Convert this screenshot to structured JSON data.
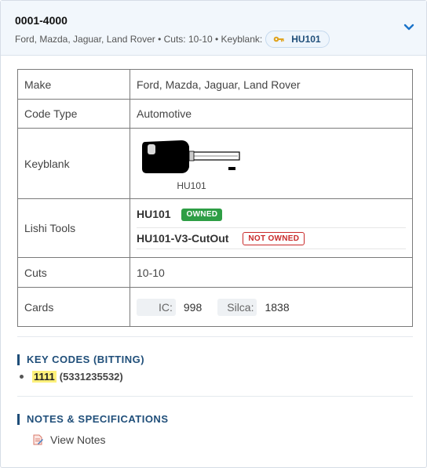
{
  "header": {
    "title": "0001-4000",
    "subtitle": "Ford, Mazda, Jaguar, Land Rover • Cuts: 10-10 • Keyblank:",
    "keyblank_pill": "HU101"
  },
  "spec_table": {
    "make": {
      "label": "Make",
      "value": "Ford, Mazda, Jaguar, Land Rover"
    },
    "code_type": {
      "label": "Code Type",
      "value": "Automotive"
    },
    "keyblank": {
      "label": "Keyblank",
      "caption": "HU101"
    },
    "lishi": {
      "label": "Lishi Tools",
      "tools": [
        {
          "name": "HU101",
          "status": "OWNED"
        },
        {
          "name": "HU101-V3-CutOut",
          "status": "NOT OWNED"
        }
      ]
    },
    "cuts": {
      "label": "Cuts",
      "value": "10-10"
    },
    "cards": {
      "label": "Cards",
      "items": [
        {
          "tag": "IC:",
          "value": "998"
        },
        {
          "tag": "Silca:",
          "value": "1838"
        }
      ]
    }
  },
  "key_codes": {
    "title": "KEY CODES (BITTING)",
    "items": [
      {
        "code": "1111",
        "bitting": "(5331235532)"
      }
    ]
  },
  "notes": {
    "title": "NOTES & SPECIFICATIONS",
    "link": "View Notes"
  },
  "colors": {
    "accent": "#1f4e79",
    "owned": "#2e9e45",
    "not_owned": "#c92a2a",
    "highlight": "#fdf07a"
  }
}
